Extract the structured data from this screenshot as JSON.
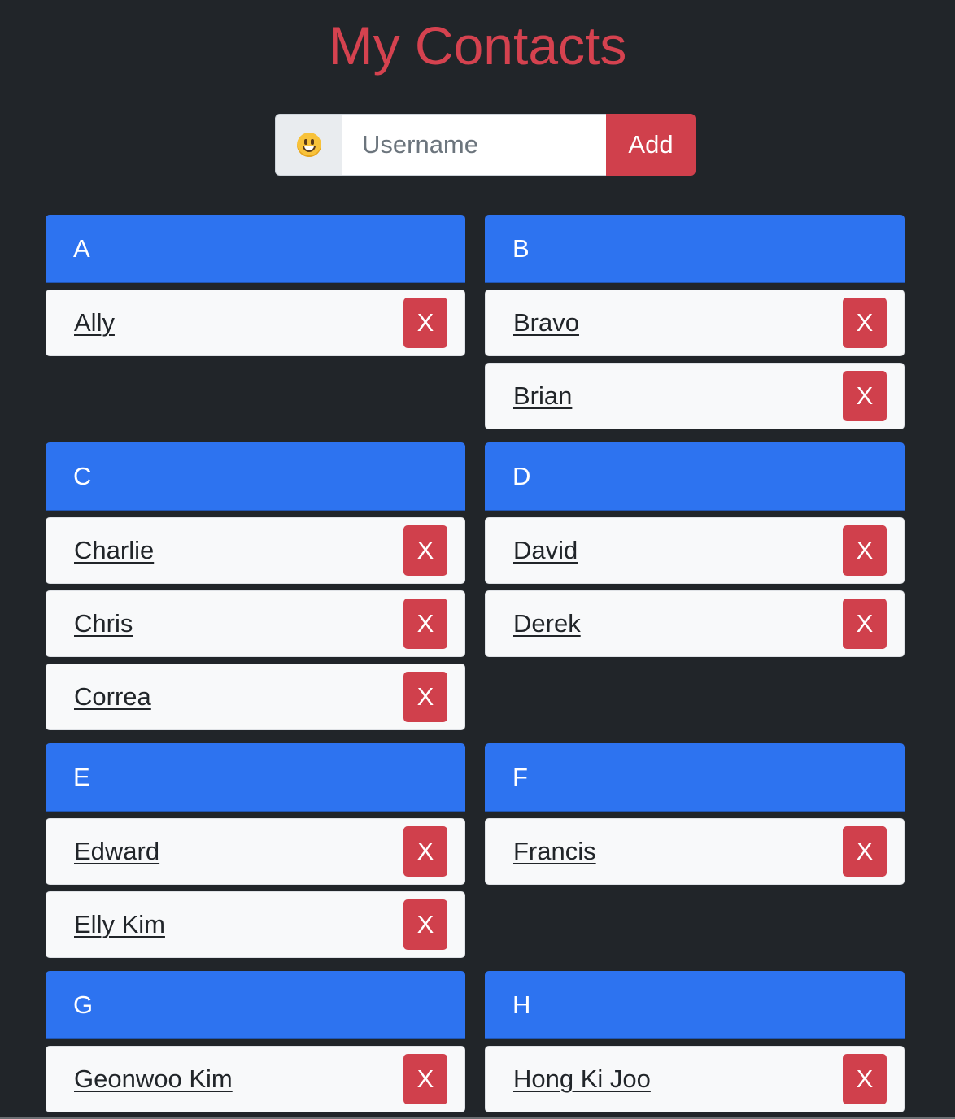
{
  "header": {
    "title": "My Contacts"
  },
  "add_form": {
    "emoji_icon": "grinning-face-emoji",
    "placeholder": "Username",
    "value": "",
    "add_label": "Add"
  },
  "delete_label": "X",
  "colors": {
    "background": "#212529",
    "title": "#d5424f",
    "group_header": "#2d73f0",
    "danger": "#d0404c",
    "card": "#f8f9fa"
  },
  "groups": [
    {
      "letter": "A",
      "contacts": [
        "Ally"
      ]
    },
    {
      "letter": "B",
      "contacts": [
        "Bravo",
        "Brian"
      ]
    },
    {
      "letter": "C",
      "contacts": [
        "Charlie",
        "Chris",
        "Correa"
      ]
    },
    {
      "letter": "D",
      "contacts": [
        "David",
        "Derek"
      ]
    },
    {
      "letter": "E",
      "contacts": [
        "Edward",
        "Elly Kim"
      ]
    },
    {
      "letter": "F",
      "contacts": [
        "Francis"
      ]
    },
    {
      "letter": "G",
      "contacts": [
        "Geonwoo Kim"
      ]
    },
    {
      "letter": "H",
      "contacts": [
        "Hong Ki Joo"
      ]
    }
  ]
}
